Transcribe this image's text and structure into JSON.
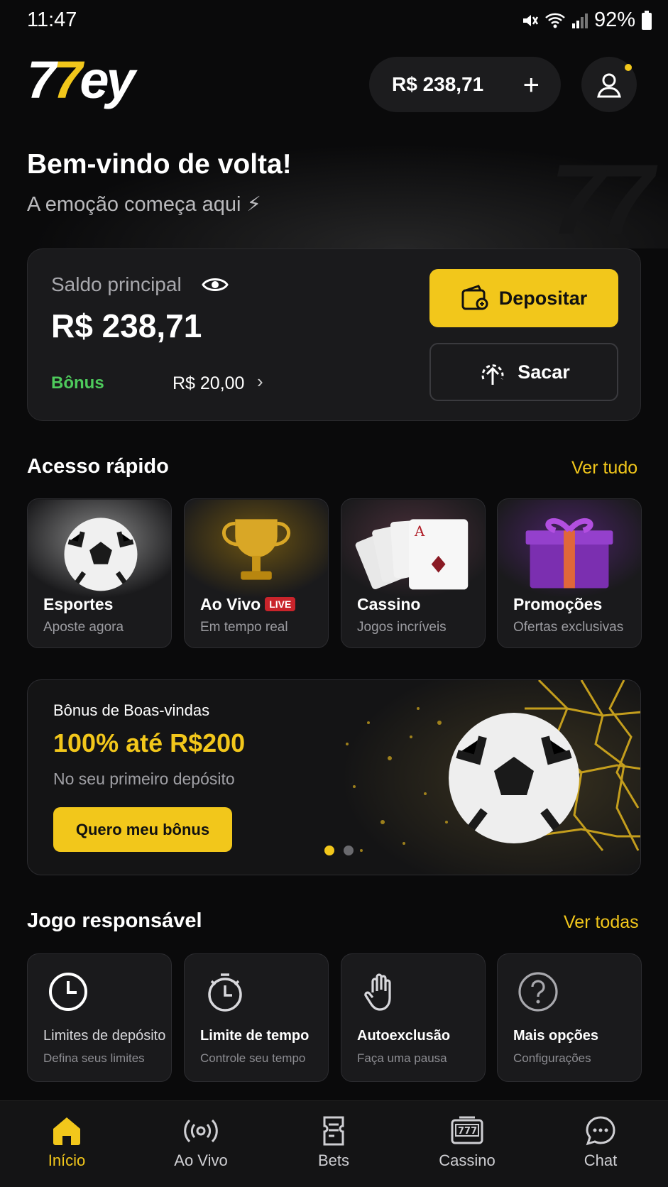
{
  "status_bar": {
    "time": "11:47",
    "battery": "92%"
  },
  "header": {
    "logo_text_a": "7",
    "logo_text_b": "7",
    "logo_text_c": "ey",
    "balance": "R$ 238,71",
    "add_icon": "plus-icon",
    "profile_icon": "user-icon"
  },
  "welcome": {
    "title": "Bem-vindo de volta!",
    "tagline": "A emoção começa aqui ⚡"
  },
  "balance_card": {
    "label": "Saldo principal",
    "value": "R$ 238,71",
    "bonus_label": "Bônus",
    "bonus_value": "R$ 20,00",
    "deposit_label": "Depositar",
    "withdraw_label": "Sacar"
  },
  "quick_access": {
    "title": "Acesso rápido",
    "link": "Ver tudo",
    "items": [
      {
        "title": "Esportes",
        "subtitle": "Aposte agora"
      },
      {
        "title": "Ao Vivo",
        "badge": "LIVE",
        "subtitle": "Em tempo real"
      },
      {
        "title": "Cassino",
        "subtitle": "Jogos incríveis"
      },
      {
        "title": "Promoções",
        "subtitle": "Ofertas exclusivas"
      }
    ]
  },
  "promo": {
    "label": "Bônus de Boas-vindas",
    "headline": "100% até R$200",
    "subtitle": "No seu primeiro depósito",
    "button": "Quero meu bônus",
    "slides": 2,
    "active_slide": 1
  },
  "responsible": {
    "title": "Jogo responsável",
    "link": "Ver todas",
    "items": [
      {
        "title": "Limites de depósito",
        "subtitle": "Defina seus limites",
        "icon": "clock-icon"
      },
      {
        "title": "Limite de tempo",
        "subtitle": "Controle seu tempo",
        "icon": "stopwatch-icon"
      },
      {
        "title": "Autoexclusão",
        "subtitle": "Faça uma pausa",
        "icon": "hand-icon"
      },
      {
        "title": "Mais opções",
        "subtitle": "Configurações",
        "icon": "question-icon"
      }
    ]
  },
  "nav": {
    "items": [
      {
        "label": "Início",
        "icon": "home-icon",
        "active": true
      },
      {
        "label": "Ao Vivo",
        "icon": "broadcast-icon",
        "active": false
      },
      {
        "label": "Bets",
        "icon": "ticket-icon",
        "active": false
      },
      {
        "label": "Cassino",
        "icon": "slot-machine-icon",
        "active": false
      },
      {
        "label": "Chat",
        "icon": "chat-icon",
        "active": false
      }
    ]
  },
  "colors": {
    "accent": "#f2c71b",
    "bonus_green": "#4ecb5c",
    "live_red": "#c9242b",
    "background": "#0a0a0b"
  }
}
